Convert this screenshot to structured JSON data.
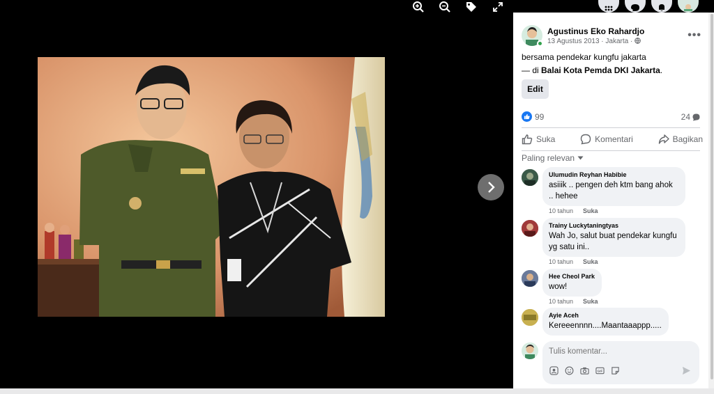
{
  "viewer": {
    "tools": [
      "zoom-in-icon",
      "zoom-out-icon",
      "tag-icon",
      "fullscreen-icon"
    ],
    "next": "chevron-right-icon"
  },
  "topnav": [
    "menu-grid-icon",
    "messenger-icon",
    "bell-icon",
    "profile-avatar"
  ],
  "post": {
    "author": "Agustinus Eko Rahardjo",
    "date": "13 Agustus 2013",
    "location": "Jakarta",
    "caption": "bersama pendekar kungfu jakarta",
    "place_prefix": "— di ",
    "place": "Balai Kota Pemda DKI Jakarta",
    "place_suffix": ".",
    "edit_label": "Edit",
    "likes": "99",
    "comments": "24"
  },
  "actions": {
    "like": "Suka",
    "comment": "Komentari",
    "share": "Bagikan"
  },
  "sort_label": "Paling relevan",
  "comments": [
    {
      "name": "Ulumudin Reyhan Habibie",
      "text": "asiiik .. pengen deh ktm bang ahok .. hehee",
      "time": "10 tahun",
      "like": "Suka"
    },
    {
      "name": "Trainy Luckytaningtyas",
      "text": "Wah Jo, salut buat pendekar kungfu yg satu ini..",
      "time": "10 tahun",
      "like": "Suka"
    },
    {
      "name": "Hee Cheol Park",
      "text": "wow!",
      "time": "10 tahun",
      "like": "Suka"
    },
    {
      "name": "Ayie Aceh",
      "text": "Kereeennnn....Maantaaappp.....",
      "time": "",
      "like": ""
    }
  ],
  "compose": {
    "placeholder": "Tulis komentar..."
  },
  "colors": {
    "accent": "#1877f2",
    "panel_bg": "#ffffff",
    "bubble": "#f0f2f5"
  }
}
